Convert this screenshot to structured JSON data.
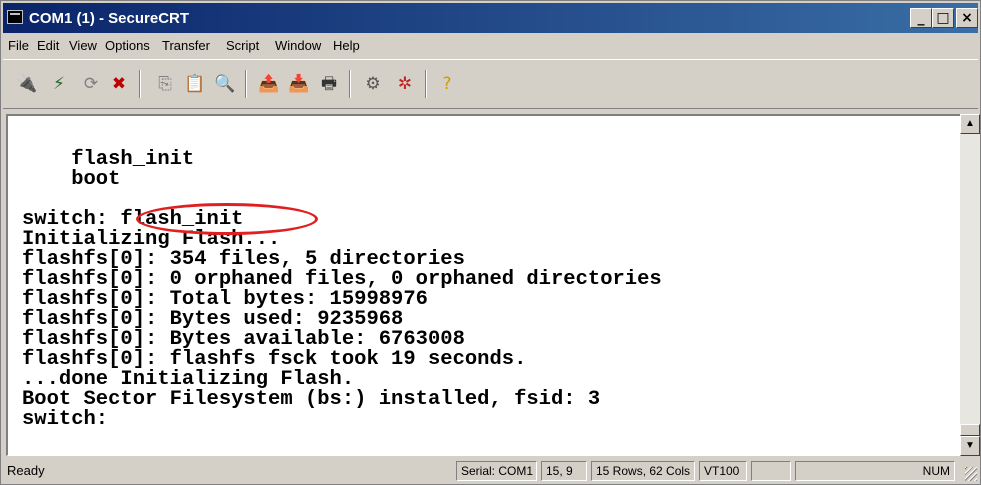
{
  "window": {
    "title": "COM1 (1) - SecureCRT"
  },
  "title_buttons": [
    "_",
    "□",
    "×"
  ],
  "menu": [
    "File",
    "Edit",
    "View",
    "Options",
    "Transfer",
    "Script",
    "Window",
    "Help"
  ],
  "toolbar": [
    {
      "icon": "connect-icon",
      "glyph": "🔌"
    },
    {
      "icon": "quick-connect-icon",
      "glyph": "⚡"
    },
    {
      "icon": "reconnect-icon",
      "glyph": "⟳"
    },
    {
      "icon": "disconnect-icon",
      "glyph": "✖"
    },
    {
      "icon": "copy-icon",
      "glyph": "⎘"
    },
    {
      "icon": "paste-icon",
      "glyph": "📋"
    },
    {
      "icon": "find-icon",
      "glyph": "🔍"
    },
    {
      "icon": "send-file-icon",
      "glyph": "📤"
    },
    {
      "icon": "receive-file-icon",
      "glyph": "📥"
    },
    {
      "icon": "print-icon",
      "glyph": "🖶"
    },
    {
      "icon": "session-options-icon",
      "glyph": "⚙"
    },
    {
      "icon": "global-options-icon",
      "glyph": "✲"
    },
    {
      "icon": "help-icon",
      "glyph": "?"
    }
  ],
  "terminal": {
    "lines": [
      "    flash_init",
      "    boot",
      "",
      "switch: flash_init",
      "Initializing Flash...",
      "flashfs[0]: 354 files, 5 directories",
      "flashfs[0]: 0 orphaned files, 0 orphaned directories",
      "flashfs[0]: Total bytes: 15998976",
      "flashfs[0]: Bytes used: 9235968",
      "flashfs[0]: Bytes available: 6763008",
      "flashfs[0]: flashfs fsck took 19 seconds.",
      "...done Initializing Flash.",
      "Boot Sector Filesystem (bs:) installed, fsid: 3",
      "switch:"
    ],
    "highlight_color": "#e02020"
  },
  "scrollbar": {
    "up": "▲",
    "down": "▼"
  },
  "status": {
    "ready": "Ready",
    "serial": "Serial: COM1",
    "cursor": "15,  9",
    "size": "15 Rows, 62 Cols",
    "emulation": "VT100",
    "blank": "",
    "num": "NUM"
  }
}
